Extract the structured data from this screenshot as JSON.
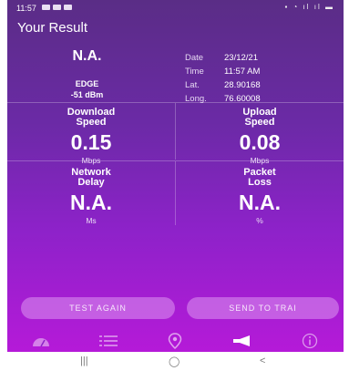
{
  "status": {
    "time": "11:57"
  },
  "page_title": "Your Result",
  "network": {
    "type": "N.A.",
    "tech": "EDGE",
    "signal": "-51 dBm"
  },
  "meta": [
    {
      "label": "Date",
      "value": "23/12/21"
    },
    {
      "label": "Time",
      "value": "11:57 AM"
    },
    {
      "label": "Lat.",
      "value": "28.90168"
    },
    {
      "label": "Long.",
      "value": "76.60008"
    }
  ],
  "metrics": {
    "download": {
      "label1": "Download",
      "label2": "Speed",
      "value": "0.15",
      "unit": "Mbps"
    },
    "upload": {
      "label1": "Upload",
      "label2": "Speed",
      "value": "0.08",
      "unit": "Mbps"
    },
    "delay": {
      "label1": "Network",
      "label2": "Delay",
      "value": "N.A.",
      "unit": "Ms"
    },
    "loss": {
      "label1": "Packet",
      "label2": "Loss",
      "value": "N.A.",
      "unit": "%"
    }
  },
  "buttons": {
    "test_again": "TEST AGAIN",
    "send_trai": "SEND TO TRAI"
  },
  "nav": [
    "speedometer-icon",
    "list-icon",
    "location-pin-icon",
    "megaphone-icon",
    "info-icon"
  ],
  "sysbar": {
    "recent": "|||",
    "home": "◯",
    "back": "<"
  },
  "colors": {
    "accent_button": "#dc96f0",
    "background_top": "#5a2d86",
    "background_bottom": "#b51ad8"
  }
}
